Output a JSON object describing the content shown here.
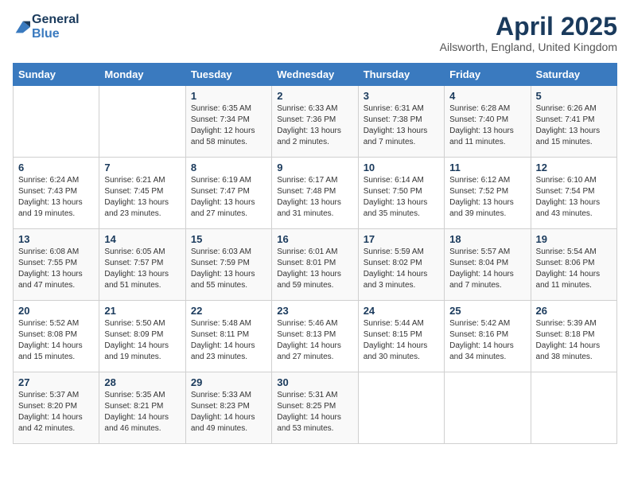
{
  "header": {
    "logo_line1": "General",
    "logo_line2": "Blue",
    "month": "April 2025",
    "location": "Ailsworth, England, United Kingdom"
  },
  "days_of_week": [
    "Sunday",
    "Monday",
    "Tuesday",
    "Wednesday",
    "Thursday",
    "Friday",
    "Saturday"
  ],
  "weeks": [
    [
      {
        "num": "",
        "sunrise": "",
        "sunset": "",
        "daylight": ""
      },
      {
        "num": "",
        "sunrise": "",
        "sunset": "",
        "daylight": ""
      },
      {
        "num": "1",
        "sunrise": "Sunrise: 6:35 AM",
        "sunset": "Sunset: 7:34 PM",
        "daylight": "Daylight: 12 hours and 58 minutes."
      },
      {
        "num": "2",
        "sunrise": "Sunrise: 6:33 AM",
        "sunset": "Sunset: 7:36 PM",
        "daylight": "Daylight: 13 hours and 2 minutes."
      },
      {
        "num": "3",
        "sunrise": "Sunrise: 6:31 AM",
        "sunset": "Sunset: 7:38 PM",
        "daylight": "Daylight: 13 hours and 7 minutes."
      },
      {
        "num": "4",
        "sunrise": "Sunrise: 6:28 AM",
        "sunset": "Sunset: 7:40 PM",
        "daylight": "Daylight: 13 hours and 11 minutes."
      },
      {
        "num": "5",
        "sunrise": "Sunrise: 6:26 AM",
        "sunset": "Sunset: 7:41 PM",
        "daylight": "Daylight: 13 hours and 15 minutes."
      }
    ],
    [
      {
        "num": "6",
        "sunrise": "Sunrise: 6:24 AM",
        "sunset": "Sunset: 7:43 PM",
        "daylight": "Daylight: 13 hours and 19 minutes."
      },
      {
        "num": "7",
        "sunrise": "Sunrise: 6:21 AM",
        "sunset": "Sunset: 7:45 PM",
        "daylight": "Daylight: 13 hours and 23 minutes."
      },
      {
        "num": "8",
        "sunrise": "Sunrise: 6:19 AM",
        "sunset": "Sunset: 7:47 PM",
        "daylight": "Daylight: 13 hours and 27 minutes."
      },
      {
        "num": "9",
        "sunrise": "Sunrise: 6:17 AM",
        "sunset": "Sunset: 7:48 PM",
        "daylight": "Daylight: 13 hours and 31 minutes."
      },
      {
        "num": "10",
        "sunrise": "Sunrise: 6:14 AM",
        "sunset": "Sunset: 7:50 PM",
        "daylight": "Daylight: 13 hours and 35 minutes."
      },
      {
        "num": "11",
        "sunrise": "Sunrise: 6:12 AM",
        "sunset": "Sunset: 7:52 PM",
        "daylight": "Daylight: 13 hours and 39 minutes."
      },
      {
        "num": "12",
        "sunrise": "Sunrise: 6:10 AM",
        "sunset": "Sunset: 7:54 PM",
        "daylight": "Daylight: 13 hours and 43 minutes."
      }
    ],
    [
      {
        "num": "13",
        "sunrise": "Sunrise: 6:08 AM",
        "sunset": "Sunset: 7:55 PM",
        "daylight": "Daylight: 13 hours and 47 minutes."
      },
      {
        "num": "14",
        "sunrise": "Sunrise: 6:05 AM",
        "sunset": "Sunset: 7:57 PM",
        "daylight": "Daylight: 13 hours and 51 minutes."
      },
      {
        "num": "15",
        "sunrise": "Sunrise: 6:03 AM",
        "sunset": "Sunset: 7:59 PM",
        "daylight": "Daylight: 13 hours and 55 minutes."
      },
      {
        "num": "16",
        "sunrise": "Sunrise: 6:01 AM",
        "sunset": "Sunset: 8:01 PM",
        "daylight": "Daylight: 13 hours and 59 minutes."
      },
      {
        "num": "17",
        "sunrise": "Sunrise: 5:59 AM",
        "sunset": "Sunset: 8:02 PM",
        "daylight": "Daylight: 14 hours and 3 minutes."
      },
      {
        "num": "18",
        "sunrise": "Sunrise: 5:57 AM",
        "sunset": "Sunset: 8:04 PM",
        "daylight": "Daylight: 14 hours and 7 minutes."
      },
      {
        "num": "19",
        "sunrise": "Sunrise: 5:54 AM",
        "sunset": "Sunset: 8:06 PM",
        "daylight": "Daylight: 14 hours and 11 minutes."
      }
    ],
    [
      {
        "num": "20",
        "sunrise": "Sunrise: 5:52 AM",
        "sunset": "Sunset: 8:08 PM",
        "daylight": "Daylight: 14 hours and 15 minutes."
      },
      {
        "num": "21",
        "sunrise": "Sunrise: 5:50 AM",
        "sunset": "Sunset: 8:09 PM",
        "daylight": "Daylight: 14 hours and 19 minutes."
      },
      {
        "num": "22",
        "sunrise": "Sunrise: 5:48 AM",
        "sunset": "Sunset: 8:11 PM",
        "daylight": "Daylight: 14 hours and 23 minutes."
      },
      {
        "num": "23",
        "sunrise": "Sunrise: 5:46 AM",
        "sunset": "Sunset: 8:13 PM",
        "daylight": "Daylight: 14 hours and 27 minutes."
      },
      {
        "num": "24",
        "sunrise": "Sunrise: 5:44 AM",
        "sunset": "Sunset: 8:15 PM",
        "daylight": "Daylight: 14 hours and 30 minutes."
      },
      {
        "num": "25",
        "sunrise": "Sunrise: 5:42 AM",
        "sunset": "Sunset: 8:16 PM",
        "daylight": "Daylight: 14 hours and 34 minutes."
      },
      {
        "num": "26",
        "sunrise": "Sunrise: 5:39 AM",
        "sunset": "Sunset: 8:18 PM",
        "daylight": "Daylight: 14 hours and 38 minutes."
      }
    ],
    [
      {
        "num": "27",
        "sunrise": "Sunrise: 5:37 AM",
        "sunset": "Sunset: 8:20 PM",
        "daylight": "Daylight: 14 hours and 42 minutes."
      },
      {
        "num": "28",
        "sunrise": "Sunrise: 5:35 AM",
        "sunset": "Sunset: 8:21 PM",
        "daylight": "Daylight: 14 hours and 46 minutes."
      },
      {
        "num": "29",
        "sunrise": "Sunrise: 5:33 AM",
        "sunset": "Sunset: 8:23 PM",
        "daylight": "Daylight: 14 hours and 49 minutes."
      },
      {
        "num": "30",
        "sunrise": "Sunrise: 5:31 AM",
        "sunset": "Sunset: 8:25 PM",
        "daylight": "Daylight: 14 hours and 53 minutes."
      },
      {
        "num": "",
        "sunrise": "",
        "sunset": "",
        "daylight": ""
      },
      {
        "num": "",
        "sunrise": "",
        "sunset": "",
        "daylight": ""
      },
      {
        "num": "",
        "sunrise": "",
        "sunset": "",
        "daylight": ""
      }
    ]
  ]
}
